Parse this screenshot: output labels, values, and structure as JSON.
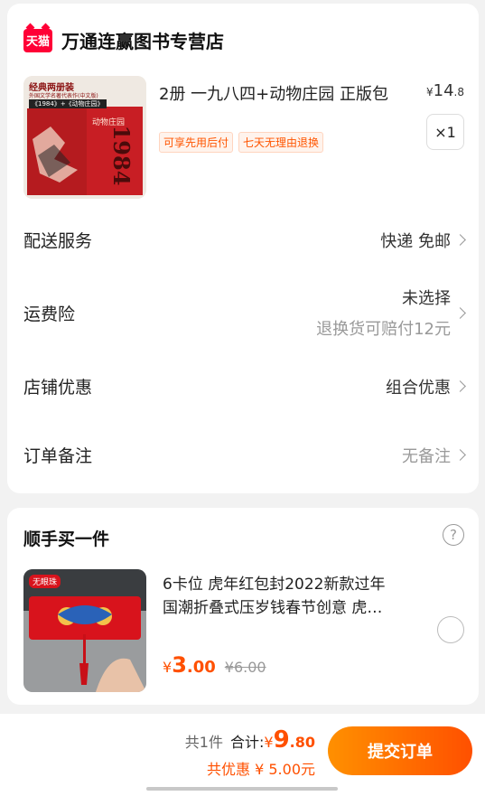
{
  "shop": {
    "logo_text": "天猫",
    "name": "万通连赢图书专营店"
  },
  "product": {
    "image_lines": [
      "经典两册装",
      "外国文学名著代表作(中文版)",
      "《1984》+《动物庄园》",
      "动物庄园",
      "1984"
    ],
    "title": "2册 一九八四+动物庄园 正版包",
    "price_symbol": "¥",
    "price_int": "14",
    "price_dec": ".8",
    "tags": [
      "可享先用后付",
      "七天无理由退换"
    ],
    "quantity": "×1"
  },
  "rows": {
    "delivery": {
      "label": "配送服务",
      "value": "快递 免邮"
    },
    "insurance": {
      "label": "运费险",
      "value": "未选择",
      "sub": "退换货可赔付12元"
    },
    "discount": {
      "label": "店铺优惠",
      "value": "组合优惠"
    },
    "note": {
      "label": "订单备注",
      "value": "无备注"
    }
  },
  "suggest": {
    "title": "顺手买一件",
    "image_badge": "无眼珠",
    "line1": "6卡位 虎年红包封2022新款过年",
    "line2": "国潮折叠式压岁钱春节创意 虎…",
    "price_symbol": "¥",
    "price_int": "3",
    "price_dec": ".00",
    "orig_price": "¥6.00"
  },
  "summary": {
    "count": "共1件",
    "total_label": "合计:",
    "total_symbol": "¥",
    "total_int": "9",
    "total_dec": ".80",
    "saved": "共优惠 ¥ 5.00元",
    "submit": "提交订单"
  },
  "colors": {
    "accent": "#ff5000",
    "tmall_red": "#ff0036"
  }
}
